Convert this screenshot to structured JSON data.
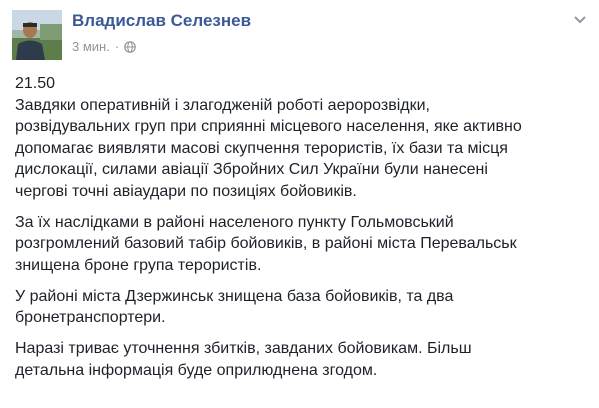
{
  "post": {
    "author": "Владислав Селезнев",
    "time": "3 мин.",
    "privacy_icon": "globe-icon",
    "menu_icon": "chevron-down-icon",
    "avatar_icon": "profile-photo"
  },
  "content": {
    "paragraphs": [
      {
        "lines": [
          "21.50",
          "Завдяки оперативній і злагодженій роботі аеророзвідки,",
          "розвідувальних груп при сприянні місцевого населення, яке активно",
          "допомагає виявляти масові скупчення терористів, їх бази та місця",
          "дислокації, силами авіації Збройних Сил України були нанесені",
          "чергові точні авіаудари по позиціях бойовиків."
        ]
      },
      {
        "lines": [
          "За їх наслідками в районі населеного пункту Гольмовський",
          "розгромлений базовий табір бойовиків, в районі міста Перевальськ",
          "знищена броне група терористів."
        ]
      },
      {
        "lines": [
          "У районі міста Дзержинськ знищена база бойовиків, та два",
          "бронетранспортери."
        ]
      },
      {
        "lines": [
          "Наразі триває уточнення збитків, завданих бойовикам. Більш",
          "детальна інформація буде оприлюднена згодом."
        ]
      }
    ]
  }
}
